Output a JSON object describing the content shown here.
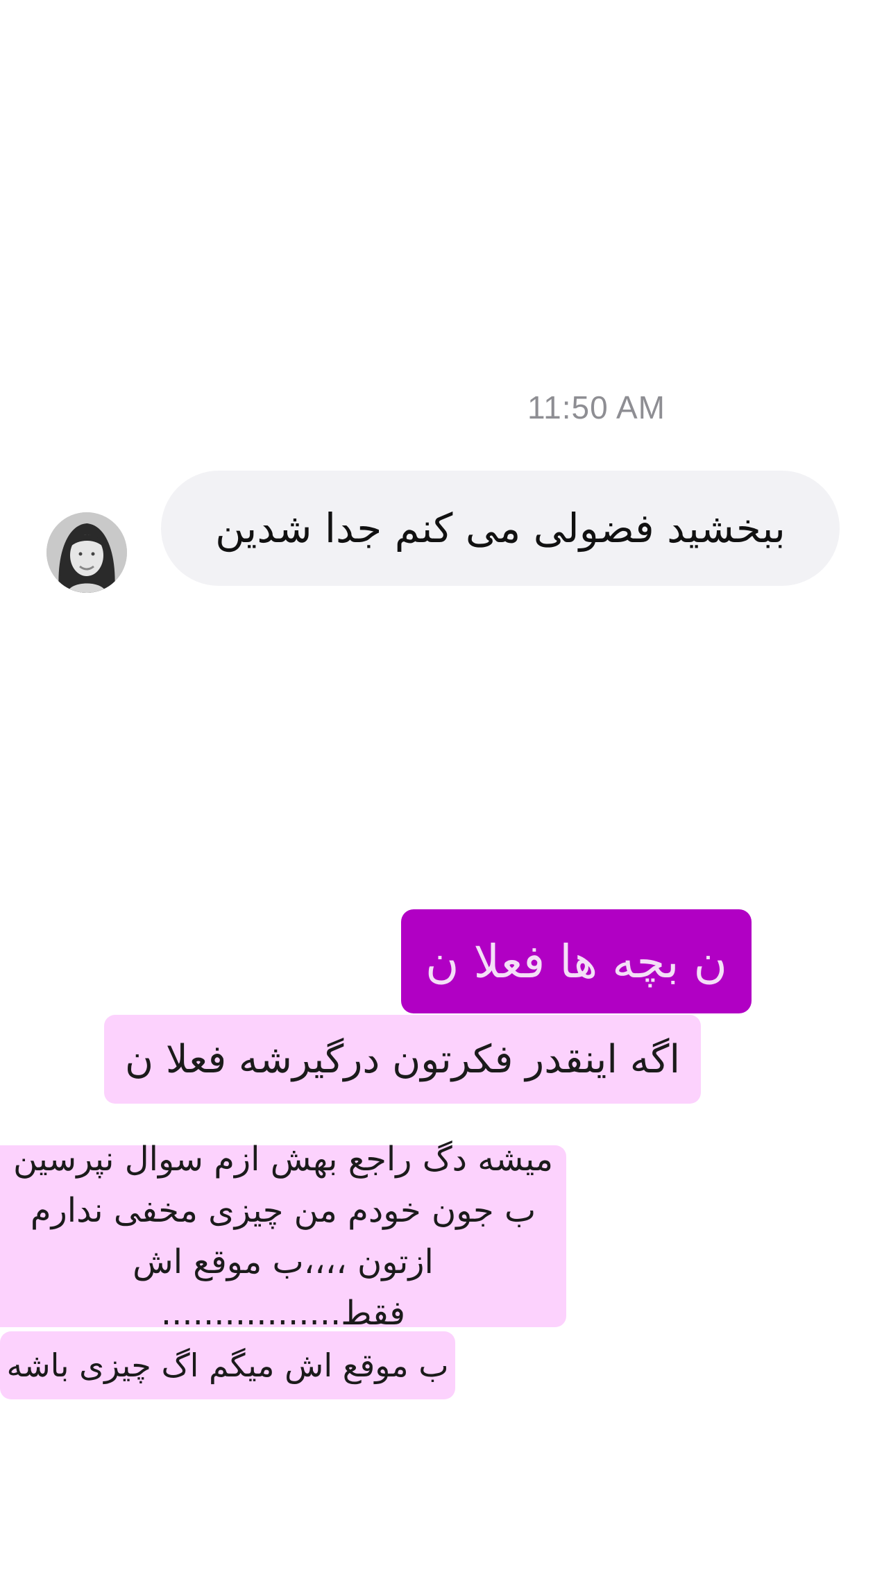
{
  "conversation": {
    "timestamp": "11:50 AM",
    "incoming_message": {
      "text": "ببخشید فضولی می کنم جدا شدین",
      "bubble_color": "#f2f2f5"
    },
    "avatar_icon": "profile-photo-icon",
    "stickers": [
      {
        "text": "ن بچه ها فعلا ن",
        "background": "#b100c4",
        "text_color": "#f4dff7"
      },
      {
        "text": "اگه اینقدر فکرتون درگیرشه فعلا ن",
        "background": "#fcd2fd"
      },
      {
        "text": "میشه دگ راجع بهش ازم سوال نپرسین\nب جون خودم من چیزی مخفی ندارم\nازتون ،،،،ب موقع اش فقط.................",
        "background": "#fcd2fd"
      },
      {
        "text": "ب موقع اش میگم اگ چیزی باشه",
        "background": "#fcd2fd"
      }
    ]
  }
}
